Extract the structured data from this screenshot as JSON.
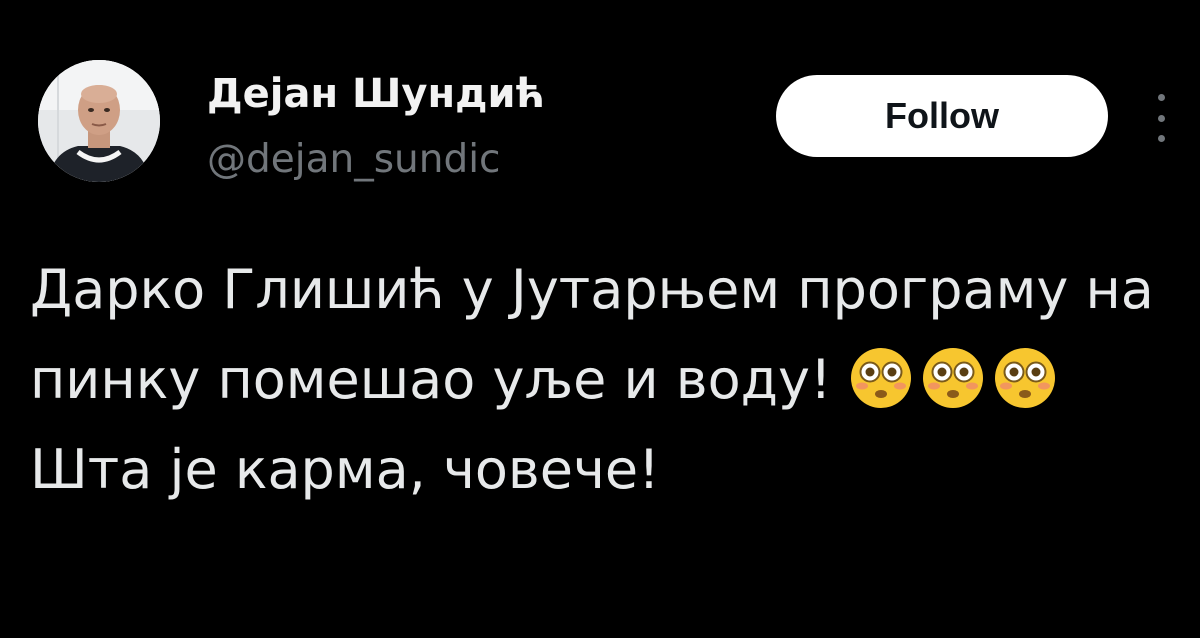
{
  "author": {
    "display_name": "Дејан Шундић",
    "handle": "@dejan_sundic",
    "avatar_icon": "profile-photo"
  },
  "actions": {
    "follow_label": "Follow",
    "more_icon": "more-vertical-icon"
  },
  "tweet": {
    "text_part1": "Дарко Глишић у Јутарњем програму на пинку помешао уље и воду!",
    "emojis": [
      "flushed-face",
      "flushed-face",
      "flushed-face"
    ],
    "text_part2": "Шта је карма, човече!"
  },
  "colors": {
    "background": "#000000",
    "text": "#e7e9ea",
    "secondary_text": "#71767b",
    "follow_button_bg": "#ffffff",
    "follow_button_text": "#0f1419",
    "emoji_yellow": "#f7c62f"
  }
}
